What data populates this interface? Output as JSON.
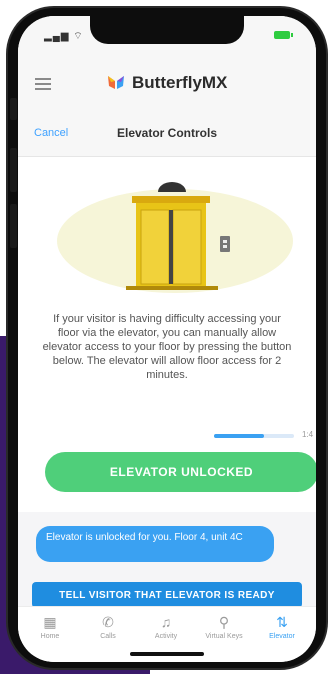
{
  "header": {
    "brand": "ButterflyMX",
    "logo_icon": "butterfly-logo-icon"
  },
  "nav": {
    "cancel_label": "Cancel",
    "title": "Elevator Controls"
  },
  "description": "If your visitor is having difficulty accessing your floor via the elevator, you can manually allow elevator access to your floor by pressing the button below. The elevator will allow floor access for 2 minutes.",
  "progress": {
    "fraction": 0.62,
    "label": "1:4"
  },
  "elevator_button": {
    "label": "ELEVATOR UNLOCKED",
    "color": "#4fcf7a"
  },
  "chat": {
    "message": "Elevator is unlocked for you. Floor 4, unit 4C",
    "action_label": "TELL VISITOR THAT ELEVATOR IS READY"
  },
  "tabs": [
    {
      "label": "Home",
      "icon": "building-icon",
      "active": false
    },
    {
      "label": "Calls",
      "icon": "phone-icon",
      "active": false
    },
    {
      "label": "Activity",
      "icon": "bell-icon",
      "active": false
    },
    {
      "label": "Virtual Keys",
      "icon": "key-icon",
      "active": false
    },
    {
      "label": "Elevator",
      "icon": "elevator-icon",
      "active": true
    }
  ],
  "colors": {
    "accent_blue": "#3aa1f2",
    "success_green": "#4fcf7a",
    "elevator_gold": "#e8c417"
  }
}
